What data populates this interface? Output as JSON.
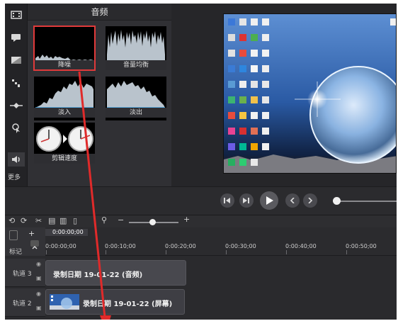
{
  "panel": {
    "title": "音频",
    "tiles": [
      {
        "label": "降噪",
        "selected": true
      },
      {
        "label": "音量均衡",
        "selected": false
      },
      {
        "label": "淡入",
        "selected": false
      },
      {
        "label": "淡出",
        "selected": false
      },
      {
        "label": "剪辑速度",
        "selected": false
      }
    ]
  },
  "sidebar": {
    "items": [
      "media-icon",
      "annotation-icon",
      "transition-icon",
      "behavior-icon",
      "animation-icon",
      "cursor-effect-icon",
      "audio-effect-icon"
    ],
    "more_label": "更多"
  },
  "timeline": {
    "playhead_time": "0:00:00;00",
    "ticks": [
      "0:00:00;00",
      "0:00:10;00",
      "0:00:20;00",
      "0:00:30;00",
      "0:00:40;00",
      "0:00:50;00"
    ],
    "marker_label": "标记",
    "tracks": [
      {
        "name": "轨道 3",
        "clip": "录制日期 19-01-22 (音频)"
      },
      {
        "name": "轨道 2",
        "clip": "录制日期 19-01-22 (屏幕)"
      }
    ]
  },
  "colors": {
    "accent_red": "#e03a3a",
    "waveform": "#b9c3cc",
    "baseline": "#3aa0e0"
  }
}
